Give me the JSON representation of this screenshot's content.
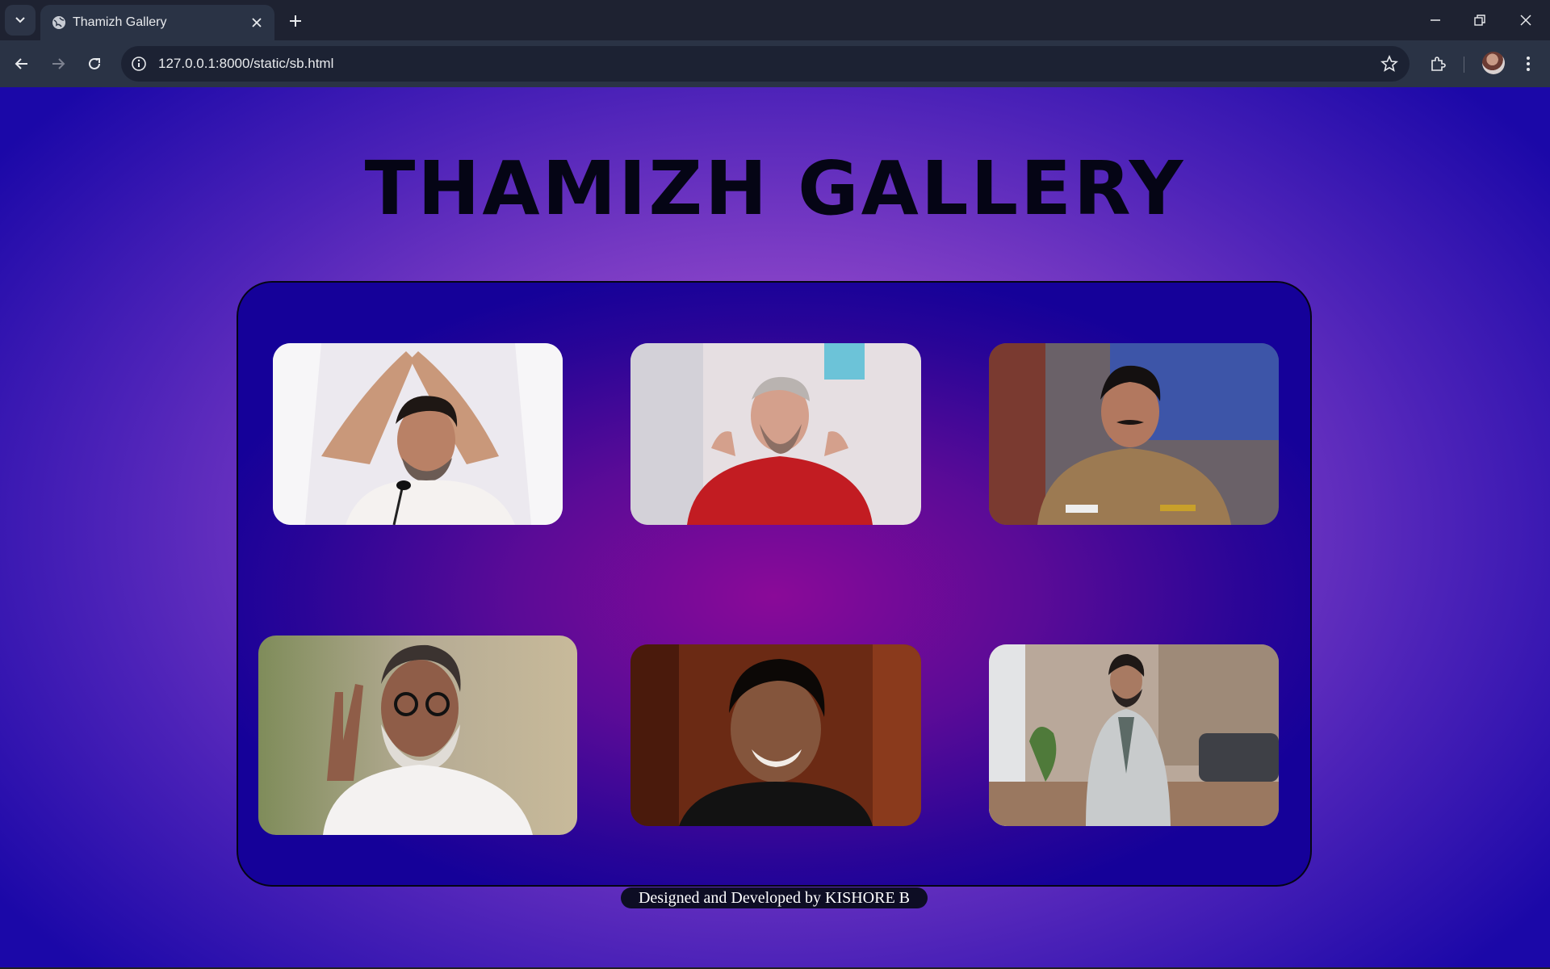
{
  "browser": {
    "tab_title": "Thamizh Gallery",
    "url": "127.0.0.1:8000/static/sb.html"
  },
  "page": {
    "title": "THAMIZH GALLERY",
    "footer": "Designed and Developed by KISHORE B"
  },
  "icons": {
    "tab_search": "chevron-down-icon",
    "favicon": "globe-icon",
    "tab_close": "close-icon",
    "new_tab": "plus-icon",
    "back": "arrow-left-icon",
    "forward": "arrow-right-icon",
    "reload": "reload-icon",
    "site_info": "info-icon",
    "bookmark": "star-icon",
    "extensions": "puzzle-icon",
    "menu": "kebab-menu-icon"
  },
  "colors": {
    "title": "#050515",
    "footer_bg": "#0d0d24",
    "footer_text": "#ffffff"
  }
}
